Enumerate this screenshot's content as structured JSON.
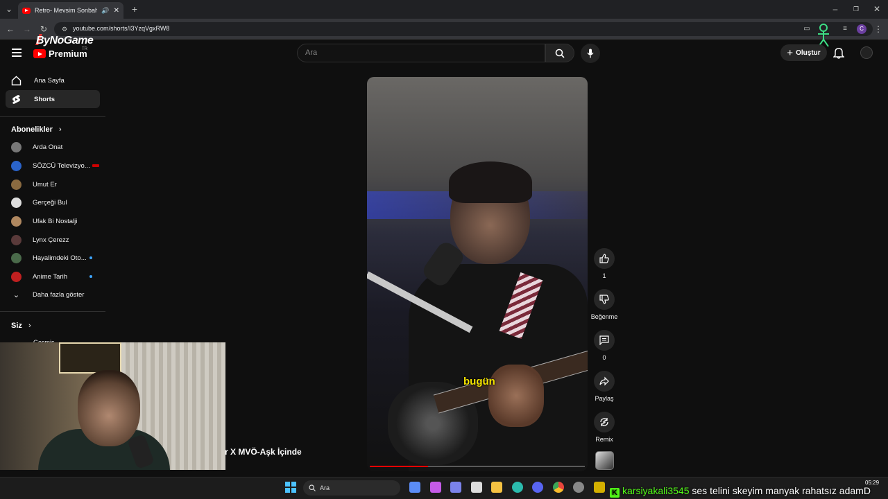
{
  "browser": {
    "tab_title": "Retro- Mevsim Sonbahar X",
    "url": "youtube.com/shorts/I3YzqVgxRW8",
    "new_tab": "+",
    "profile_initial": "C"
  },
  "overlay_brand": {
    "name": "ByNoGame",
    "premium": "Premium",
    "region": "TR"
  },
  "header": {
    "search_placeholder": "Ara",
    "create_label": "Oluştur"
  },
  "sidebar": {
    "home": "Ana Sayfa",
    "shorts": "Shorts",
    "subscriptions_title": "Abonelikler",
    "subscriptions": [
      {
        "name": "Arda Onat",
        "color": "#777777"
      },
      {
        "name": "SÖZCÜ Televizyo...",
        "color": "#2a63c9",
        "live": true
      },
      {
        "name": "Umut Er",
        "color": "#8a6a40"
      },
      {
        "name": "Gerçeği Bul",
        "color": "#dddddd"
      },
      {
        "name": "Ufak Bi Nostalji",
        "color": "#b08860"
      },
      {
        "name": "Lynx Çerezz",
        "color": "#5a3a3a"
      },
      {
        "name": "Hayalimdeki Oto...",
        "color": "#4a6a4a",
        "new": true
      },
      {
        "name": "Anime Tarih",
        "color": "#c02020",
        "new": true
      }
    ],
    "show_more": "Daha fazla göster",
    "you_title": "Siz",
    "partial_item": "Geçmiş"
  },
  "short": {
    "caption": "bugün",
    "song_title": "r X  MVÖ-Aşk İçinde",
    "progress_fraction": 0.27,
    "likes": "1",
    "dislike_label": "Beğenme",
    "comments": "0",
    "share_label": "Paylaş",
    "remix_label": "Remix"
  },
  "taskbar": {
    "search_placeholder": "Ara",
    "time": "05:29",
    "icons": [
      {
        "name": "copilot-icon",
        "color": "#5b8df7"
      },
      {
        "name": "edge-copilot-icon",
        "color": "#c55be8"
      },
      {
        "name": "teams-icon",
        "color": "#7b83eb"
      },
      {
        "name": "store-icon",
        "color": "#dddddd"
      },
      {
        "name": "file-explorer-icon",
        "color": "#f5c242"
      },
      {
        "name": "edge-icon",
        "color": "#2bbbad"
      },
      {
        "name": "discord-icon",
        "color": "#5865f2"
      },
      {
        "name": "chrome-icon",
        "color": "#e8453c"
      },
      {
        "name": "obs-icon",
        "color": "#888888"
      },
      {
        "name": "app-icon",
        "color": "#d4b000"
      }
    ]
  },
  "chat": {
    "username": "karsiyakali3545",
    "message": " ses telini skeyim manyak rahatsız adamD"
  },
  "colors": {
    "yt_red": "#ff0000",
    "kick_green": "#53fc18",
    "caption_yellow": "#f5e400"
  }
}
